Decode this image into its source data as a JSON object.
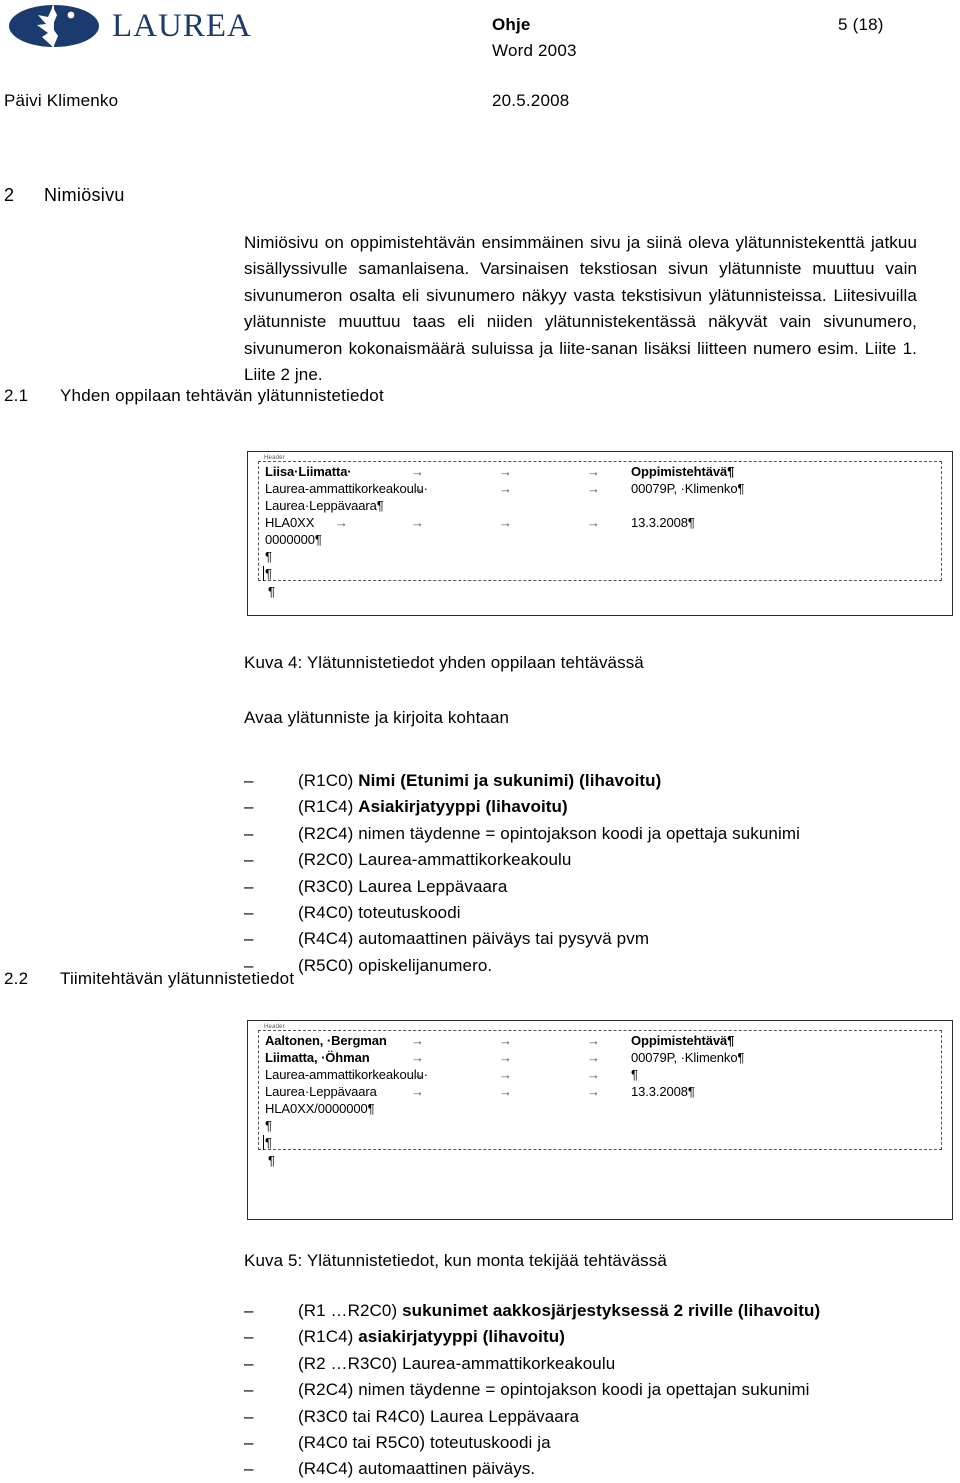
{
  "header": {
    "logo_text": "LAUREA",
    "logo_color": "#1b3b6f",
    "title": "Ohje",
    "subtitle": "Word 2003",
    "page_indicator": "5 (18)",
    "author": "Päivi Klimenko",
    "date": "20.5.2008"
  },
  "sections": {
    "h1": {
      "number": "2",
      "title": "Nimiösivu"
    },
    "h2_1": {
      "number": "2.1",
      "title": "Yhden oppilaan tehtävän ylätunnistetiedot"
    },
    "h2_2": {
      "number": "2.2",
      "title": "Tiimitehtävän ylätunnistetiedot"
    }
  },
  "intro_paragraph": "Nimiösivu on oppimistehtävän ensimmäinen sivu ja siinä oleva ylätunnistekenttä jatkuu sisällyssivulle samanlaisena. Varsinaisen tekstiosan sivun ylätunniste muuttuu vain sivunumeron osalta eli sivunumero näkyy vasta tekstisivun ylätunnisteissa. Liitesivuilla ylätunniste muuttuu taas eli niiden ylätunnistekentässä näkyvät vain sivunumero, sivunumeron kokonaismäärä suluissa ja liite-sanan lisäksi liitteen numero esim. Liite 1. Liite 2 jne.",
  "figure4": {
    "tag": "Header",
    "caption": "Kuva 4: Ylätunnistetiedot yhden oppilaan tehtävässä",
    "rows": [
      {
        "c0": "Liisa·Liimatta·",
        "c0bold": true,
        "tabs": 3,
        "c4": "Oppimistehtävä¶",
        "c4bold": true
      },
      {
        "c0": "Laurea-ammattikorkeakoulu·",
        "c0bold": false,
        "tabs": 3,
        "c4": "00079P, ·Klimenko¶",
        "c4bold": false
      },
      {
        "c0": "Laurea·Leppävaara¶",
        "c0bold": false,
        "tabs": 0,
        "c4": "",
        "c4bold": false
      },
      {
        "c0": "HLA0XX",
        "c0bold": false,
        "tabs": 4,
        "c4": "13.3.2008¶",
        "c4bold": false
      },
      {
        "c0": "0000000¶",
        "c0bold": false,
        "tabs": 0,
        "c4": "",
        "c4bold": false
      },
      {
        "c0": "¶",
        "c0bold": false,
        "tabs": 0,
        "c4": "",
        "c4bold": false
      },
      {
        "c0": "¶",
        "c0bold": false,
        "tabs": 0,
        "c4": "",
        "c4bold": false
      }
    ],
    "trailing_pilcrow": "¶"
  },
  "instruction": "Avaa ylätunniste ja kirjoita kohtaan",
  "list1": [
    {
      "bullet": "–",
      "code": "(R1C0) ",
      "bold": "Nimi (Etunimi ja sukunimi) (lihavoitu)",
      "rest": ""
    },
    {
      "bullet": "–",
      "code": "(R1C4) ",
      "bold": "Asiakirjatyyppi (lihavoitu)",
      "rest": ""
    },
    {
      "bullet": "–",
      "code": "(R2C4) ",
      "bold": "",
      "rest": "nimen täydenne = opintojakson koodi ja opettaja sukunimi"
    },
    {
      "bullet": "–",
      "code": "(R2C0) ",
      "bold": "",
      "rest": "Laurea-ammattikorkeakoulu"
    },
    {
      "bullet": "–",
      "code": "(R3C0) ",
      "bold": "",
      "rest": "Laurea Leppävaara"
    },
    {
      "bullet": "–",
      "code": "(R4C0) ",
      "bold": "",
      "rest": "toteutuskoodi"
    },
    {
      "bullet": "–",
      "code": "(R4C4) ",
      "bold": "",
      "rest": "automaattinen päiväys tai pysyvä pvm"
    },
    {
      "bullet": "–",
      "code": "(R5C0) ",
      "bold": "",
      "rest": "opiskelijanumero."
    }
  ],
  "figure5": {
    "tag": "Header",
    "caption": "Kuva 5: Ylätunnistetiedot, kun monta tekijää tehtävässä",
    "rows": [
      {
        "c0": "Aaltonen, ·Bergman",
        "c0bold": true,
        "tabs": 3,
        "c4": "Oppimistehtävä¶",
        "c4bold": true
      },
      {
        "c0": "Liimatta, ·Öhman",
        "c0bold": true,
        "tabs": 3,
        "c4": "00079P, ·Klimenko¶",
        "c4bold": false
      },
      {
        "c0": "Laurea-ammattikorkeakoulu·",
        "c0bold": false,
        "tabs": 3,
        "c4": "¶",
        "c4bold": false
      },
      {
        "c0": "Laurea·Leppävaara",
        "c0bold": false,
        "tabs": 3,
        "c4": "13.3.2008¶",
        "c4bold": false
      },
      {
        "c0": "HLA0XX/0000000¶",
        "c0bold": false,
        "tabs": 0,
        "c4": "",
        "c4bold": false
      },
      {
        "c0": "¶",
        "c0bold": false,
        "tabs": 0,
        "c4": "",
        "c4bold": false
      },
      {
        "c0": "¶",
        "c0bold": false,
        "tabs": 0,
        "c4": "",
        "c4bold": false
      }
    ],
    "trailing_pilcrow": "¶"
  },
  "list2": [
    {
      "bullet": "–",
      "code": "(R1 …R2C0) ",
      "bold": "sukunimet aakkosjärjestyksessä 2 riville (lihavoitu)",
      "rest": ""
    },
    {
      "bullet": "–",
      "code": "(R1C4) ",
      "bold": "asiakirjatyyppi (lihavoitu)",
      "rest": ""
    },
    {
      "bullet": "–",
      "code": "(R2 …R3C0) ",
      "bold": "",
      "rest": "Laurea-ammattikorkeakoulu"
    },
    {
      "bullet": "–",
      "code": "(R2C4) ",
      "bold": "",
      "rest": "nimen täydenne = opintojakson koodi ja opettajan sukunimi"
    },
    {
      "bullet": "–",
      "code": "(R3C0 tai R4C0) ",
      "bold": "",
      "rest": "Laurea Leppävaara"
    },
    {
      "bullet": "–",
      "code": "(R4C0 tai R5C0) ",
      "bold": "",
      "rest": "toteutuskoodi ja"
    },
    {
      "bullet": "–",
      "code": "(R4C4) ",
      "bold": "",
      "rest": "automaattinen päiväys."
    }
  ]
}
